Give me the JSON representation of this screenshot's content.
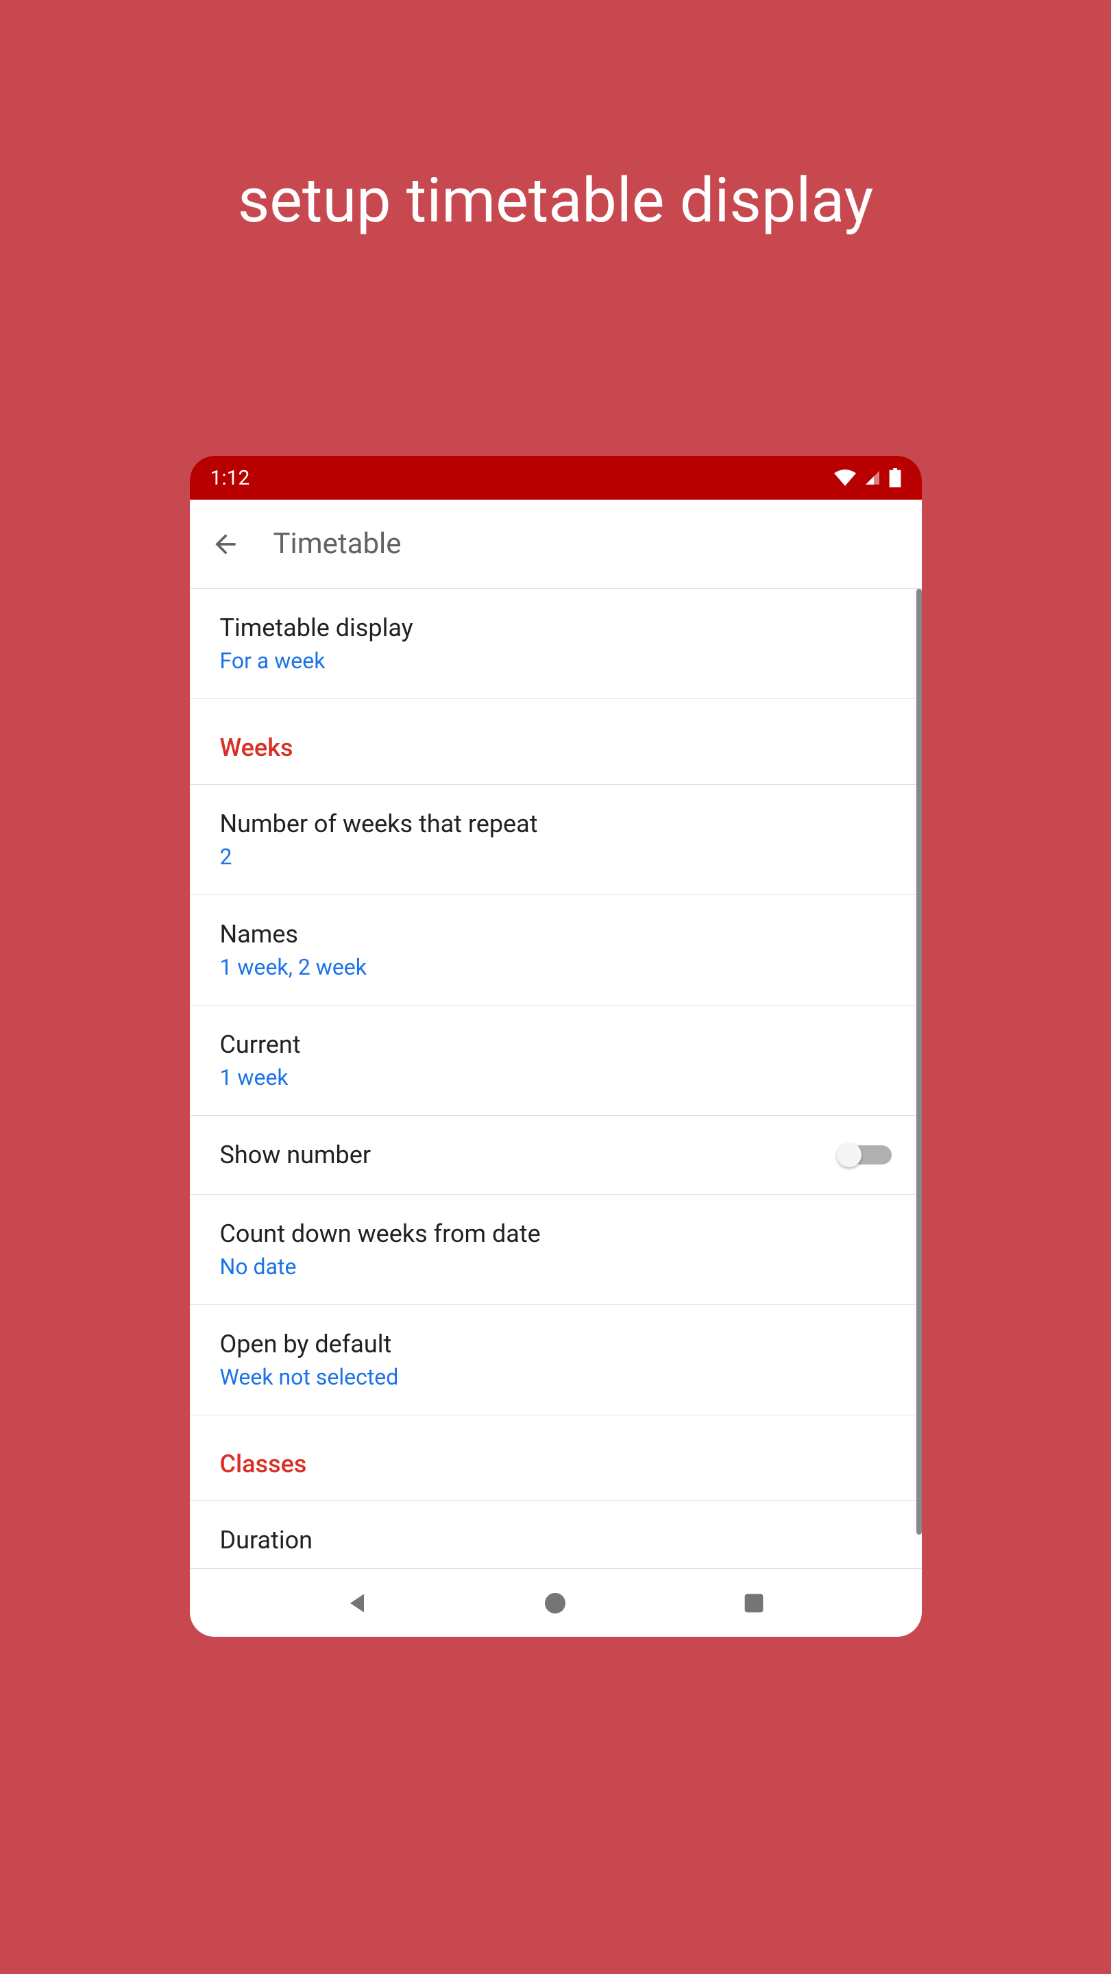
{
  "page_title": "setup timetable display",
  "status_bar": {
    "time": "1:12"
  },
  "app_bar": {
    "title": "Timetable"
  },
  "settings": {
    "timetable_display": {
      "label": "Timetable display",
      "value": "For a week"
    },
    "weeks_section": "Weeks",
    "num_weeks": {
      "label": "Number of weeks that repeat",
      "value": "2"
    },
    "names": {
      "label": "Names",
      "value": "1 week, 2 week"
    },
    "current": {
      "label": "Current",
      "value": "1 week"
    },
    "show_number": {
      "label": "Show number"
    },
    "countdown": {
      "label": "Count down weeks from date",
      "value": "No date"
    },
    "open_default": {
      "label": "Open by default",
      "value": "Week not selected"
    },
    "classes_section": "Classes",
    "duration": {
      "label": "Duration"
    }
  }
}
